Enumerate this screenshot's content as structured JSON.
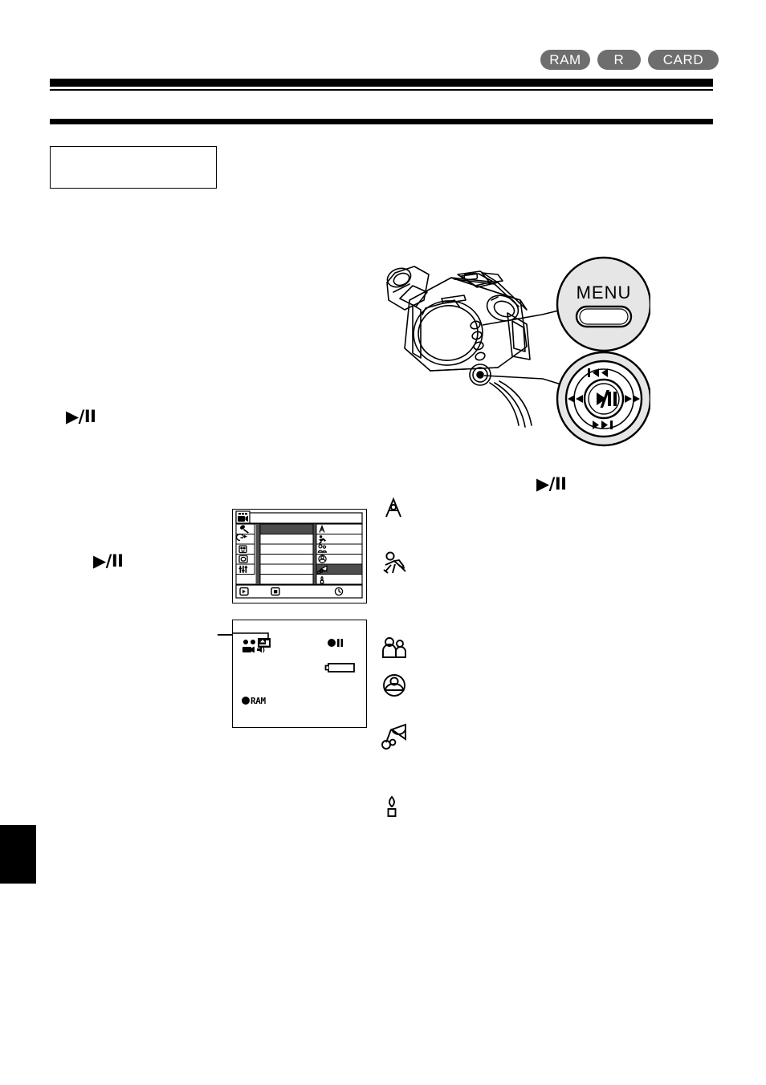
{
  "page": {
    "media_badges": [
      {
        "label": "RAM",
        "name": "badge-ram"
      },
      {
        "label": "R",
        "name": "badge-r"
      },
      {
        "label": "CARD",
        "name": "badge-card"
      }
    ],
    "accent_colors": {
      "badge_background": "#6e6e6e",
      "badge_text": "#ffffff",
      "rule": "#000000",
      "callout_fill": "#e6e6e6",
      "menu_highlight": "#4d4d4d"
    }
  },
  "note_box": {
    "text": ""
  },
  "steps": [
    {
      "name": "step-marker-1",
      "glyph": "▶/II"
    },
    {
      "name": "step-marker-2",
      "glyph": "▶/II"
    },
    {
      "name": "step-marker-3",
      "glyph": "▶/II"
    }
  ],
  "illustration": {
    "name": "camcorder-illustration",
    "callouts": [
      {
        "name": "menu-button-callout",
        "label": "MENU",
        "button_shape": "pill"
      },
      {
        "name": "navigation-ring-callout",
        "center_label": "▶/II",
        "directions": {
          "up": "|◀◀",
          "down": "▶▶|",
          "left": "◀◀",
          "right": "▶▶"
        }
      }
    ]
  },
  "menu_screen": {
    "name": "camcorder-menu-screen",
    "tab_icon": "camcorder-icon",
    "left_icons": [
      "microphone-icon",
      "fade-icon",
      "brightness-icon",
      "screen-icon",
      "settings-sliders-icon"
    ],
    "right_icons": [
      "auto-mode-icon",
      "sports-mode-icon",
      "portrait-mode-icon",
      "spotlight-mode-icon",
      "sand-snow-mode-icon",
      "low-light-mode-icon"
    ],
    "highlighted_left_row": 1,
    "highlighted_right_row": 5,
    "bottom_bar_icons": [
      "play-icon",
      "stop-icon",
      "clock-icon"
    ]
  },
  "status_screen": {
    "name": "camcorder-status-screen",
    "mode_icons": [
      "disc-icon",
      "disc-icon",
      "scene-mode-icon",
      "camera-icon",
      "speaker-icon"
    ],
    "record_indicator": "●II",
    "battery_indicator": "battery-icon",
    "disc_label": "RAM",
    "highlight_target": "scene-mode-icon"
  },
  "scene_icon_list": [
    {
      "name": "auto-mode-icon",
      "label": "A"
    },
    {
      "name": "sports-mode-icon",
      "label": ""
    },
    {
      "name": "portrait-mode-icon",
      "label": ""
    },
    {
      "name": "spotlight-mode-icon",
      "label": ""
    },
    {
      "name": "sand-snow-mode-icon",
      "label": ""
    },
    {
      "name": "low-light-mode-icon",
      "label": ""
    }
  ],
  "edge_tab": {
    "name": "page-edge-tab",
    "text": ""
  }
}
